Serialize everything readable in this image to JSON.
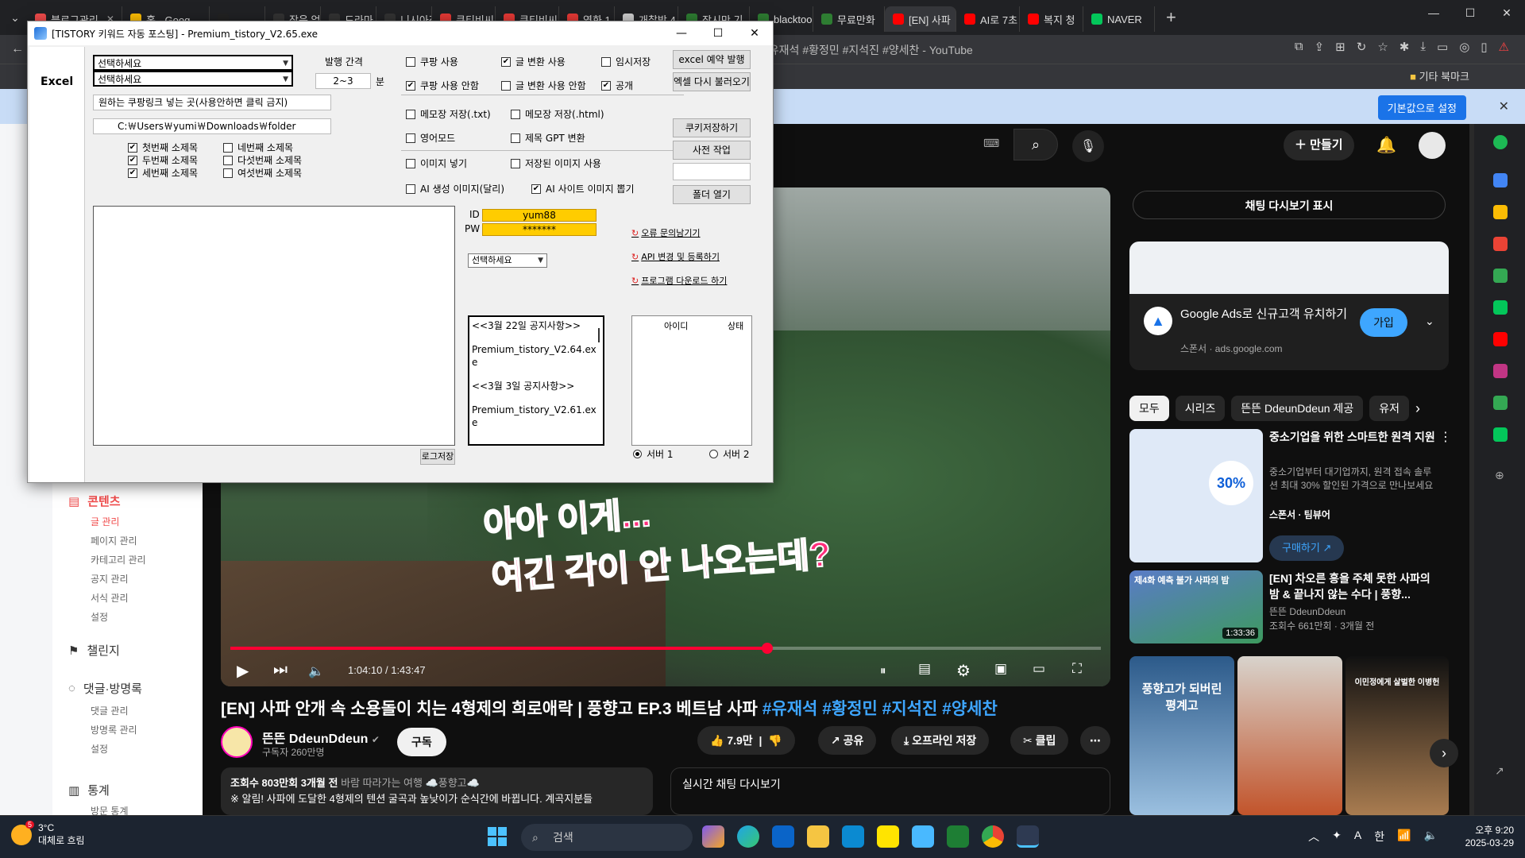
{
  "browser": {
    "tabs": [
      {
        "label": "블로그관리",
        "color": "#f04b4b",
        "active": false,
        "closable": true
      },
      {
        "label": "홈 - Goog",
        "color": "#fbbc04",
        "active": false,
        "closable": false
      },
      {
        "label": "",
        "color": "#222222",
        "active": false,
        "closable": false
      },
      {
        "label": "잡음 없",
        "color": "#333333",
        "active": false,
        "closable": false
      },
      {
        "label": "드라마 다",
        "color": "#333333",
        "active": false,
        "closable": false
      },
      {
        "label": "니시아정",
        "color": "#333333",
        "active": false,
        "closable": false
      },
      {
        "label": "쿠티비씨",
        "color": "#e53935",
        "active": false,
        "closable": false
      },
      {
        "label": "쿠티비씨",
        "color": "#e53935",
        "active": false,
        "closable": false
      },
      {
        "label": "영화 1",
        "color": "#e53935",
        "active": false,
        "closable": false
      },
      {
        "label": "개찰방 4",
        "color": "#cccccc",
        "active": false,
        "closable": false
      },
      {
        "label": "잠시만 기",
        "color": "#2e7d32",
        "active": false,
        "closable": false
      },
      {
        "label": "blacktoo",
        "color": "#2e7d32",
        "active": false,
        "closable": false
      },
      {
        "label": "무료만화",
        "color": "#2e7d32",
        "active": false,
        "closable": false
      },
      {
        "label": "[EN] 사파",
        "color": "#ff0000",
        "active": true,
        "closable": false
      },
      {
        "label": "AI로 7초",
        "color": "#ff0000",
        "active": false,
        "closable": false
      },
      {
        "label": "복지 청",
        "color": "#ff0000",
        "active": false,
        "closable": false
      },
      {
        "label": "NAVER",
        "color": "#03c75a",
        "active": false,
        "closable": false
      }
    ],
    "newtab_label": "+",
    "omnibox": "#유재석 #황정민 #지석진 #양세찬 - YouTube",
    "bookmark_folder": "기타 북마크",
    "infobar_button": "기본값으로 설정"
  },
  "tistory": {
    "sections": [
      {
        "label": "콘텐츠",
        "icon": "document-icon",
        "active": true
      },
      {
        "label": "챌린지",
        "icon": "flag-icon",
        "active": false
      },
      {
        "label": "댓글·방명록",
        "icon": "comment-icon",
        "active": false
      },
      {
        "label": "통계",
        "icon": "chart-icon",
        "active": false
      }
    ],
    "content_items": [
      "글 관리",
      "페이지 관리",
      "카테고리 관리",
      "공지 관리",
      "서식 관리",
      "설정"
    ],
    "comment_items": [
      "댓글 관리",
      "방명록 관리",
      "설정"
    ],
    "stats_items": [
      "방문 통계"
    ]
  },
  "app": {
    "title": "[TISTORY 키워드 자동 포스팅] - Premium_tistory_V2.65.exe",
    "side_tab": "Excel",
    "combo1": "선택하세요",
    "combo2": "선택하세요",
    "interval_label": "발행 간격",
    "interval_value": "2~3",
    "interval_unit": "분",
    "coupang_field": "원하는 쿠팡링크 넣는 곳(사용안하면 클릭 금지)",
    "path_field": "C:￦Users￦yumi￦Downloads￦folder",
    "subtitles": [
      {
        "label": "첫번째 소제목",
        "checked": true
      },
      {
        "label": "네번째 소제목",
        "checked": false
      },
      {
        "label": "두번째 소제목",
        "checked": true
      },
      {
        "label": "다섯번째 소제목",
        "checked": false
      },
      {
        "label": "세번째 소제목",
        "checked": true
      },
      {
        "label": "여섯번째 소제목",
        "checked": false
      }
    ],
    "options": [
      {
        "label": "쿠팡 사용",
        "checked": false
      },
      {
        "label": "글 변환 사용",
        "checked": true
      },
      {
        "label": "임시저장",
        "checked": false
      },
      {
        "label": "쿠팡 사용 안함",
        "checked": true
      },
      {
        "label": "글 변환 사용 안함",
        "checked": false
      },
      {
        "label": "공개",
        "checked": true
      },
      {
        "label": "메모장 저장(.txt)",
        "checked": false
      },
      {
        "label": "메모장 저장(.html)",
        "checked": false
      },
      {
        "label": "영어모드",
        "checked": false
      },
      {
        "label": "제목 GPT 변환",
        "checked": false
      },
      {
        "label": "이미지 넣기",
        "checked": false
      },
      {
        "label": "저장된 이미지 사용",
        "checked": false
      },
      {
        "label": "AI 생성 이미지(달리)",
        "checked": false
      },
      {
        "label": "AI 사이트 이미지 뽑기",
        "checked": true
      }
    ],
    "buttons": {
      "excel_publish": "excel 예약 발행",
      "excel_reload": "엑셀 다시 불러오기",
      "cookie_save": "쿠키저장하기",
      "pre_work": "사전 작업",
      "open_folder": "폴더 열기",
      "log_save": "로그저장"
    },
    "id_label": "ID",
    "id_value": "yum88",
    "pw_label": "PW",
    "pw_value": "*******",
    "account_combo": "선택하세요",
    "links": [
      "오류 문의남기기",
      "API 변경 및 등록하기",
      "프로그램 다운로드 하기"
    ],
    "notices": [
      "<<3월 22일 공지사항>>",
      "Premium_tistory_V2.64.exe",
      "<<3월 3일 공지사항>>",
      "Premium_tistory_V2.61.exe"
    ],
    "table_headers": [
      "아이디",
      "상태"
    ],
    "servers": [
      {
        "label": "서버 1",
        "selected": true
      },
      {
        "label": "서버 2",
        "selected": false
      }
    ]
  },
  "youtube": {
    "create_label": "만들기",
    "subtitle_line1": "아아 이게...",
    "subtitle_line2": "여긴 각이 안 나오는데?",
    "time": "1:04:10 / 1:43:47",
    "progress": 0.617,
    "title": "[EN] 사파 안개 속 소용돌이 치는 4형제의 희로애락 | 풍향고 EP.3 베트남 사파",
    "title_tags": "#유재석 #황정민 #지석진 #양세찬",
    "channel": "뜬뜬 DdeunDdeun",
    "subscribers": "구독자 260만명",
    "subscribe": "구독",
    "likes": "7.9만",
    "share": "공유",
    "offline": "오프라인 저장",
    "clip": "클립",
    "desc_meta": "조회수 803만회  3개월 전",
    "desc_extra": "바람 따라가는 여행 ☁️풍향고☁️",
    "desc_text": "※ 알림! 사파에 도달한 4형제의 텐션 굴곡과 높낮이가 순식간에 바뀝니다. 계곡지분들",
    "live_chat": "실시간 채팅 다시보기",
    "chat_replay": "채팅 다시보기 표시",
    "ad_title": "Google Ads로 신규고객 유치하기",
    "ad_sponsor": "스폰서 · ads.google.com",
    "ad_join": "가입",
    "chips": [
      "모두",
      "시리즈",
      "뜬뜬 DdeunDdeun 제공",
      "유저"
    ],
    "rec1": {
      "title": "중소기업을 위한 스마트한 원격 지원",
      "desc": "중소기업부터 대기업까지, 원격 접속 솔루션 최대 30% 할인된 가격으로 만나보세요",
      "sponsor": "스폰서 · 팀뷰어",
      "cta": "구매하기",
      "badge": "30%"
    },
    "rec2": {
      "title": "[EN] 차오른 흥을 주체 못한 사파의 밤 & 끝나지 않는 수다 | 풍향...",
      "channel": "뜬뜬 DdeunDdeun",
      "meta": "조회수 661만회 · 3개월 전",
      "duration": "1:33:36",
      "thumb_text": "제4화 예측 불가 사파의 밤"
    },
    "shorts": [
      "풍향고가 되버린 평계고",
      "",
      "이민정에게 살벌한 이병헌"
    ]
  },
  "taskbar": {
    "temp": "3°C",
    "weather": "대체로 흐림",
    "weather_badge": "5",
    "search": "검색",
    "time": "오후 9:20",
    "date": "2025-03-29",
    "ime": "A",
    "ime2": "한"
  }
}
